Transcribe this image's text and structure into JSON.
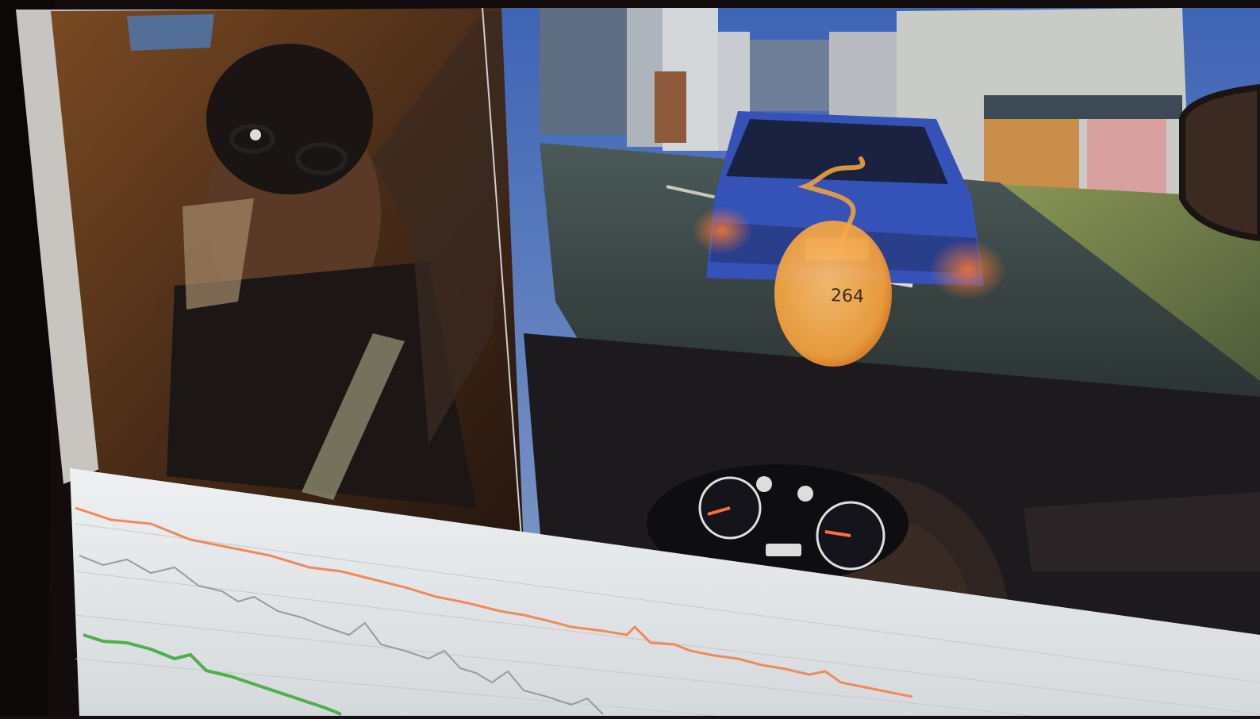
{
  "gaze_marker": {
    "value": "264",
    "color": "#f6a23c",
    "trail_color": "#f0a23a"
  },
  "colors": {
    "eeg_orange": "#ef8a5a",
    "eeg_gray": "#9a9a9a",
    "eeg_green": "#4cb04c",
    "car_blue": "#3552b8"
  }
}
